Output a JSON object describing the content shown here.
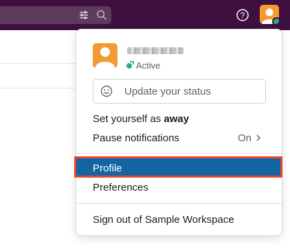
{
  "topbar": {
    "filter_icon": "sliders-icon",
    "search_icon": "search-icon",
    "help_icon": "question-circle-icon",
    "avatar_icon": "user-avatar"
  },
  "menu": {
    "status": "Active",
    "status_placeholder": "Update your status",
    "set_away_prefix": "Set yourself as ",
    "set_away_bold": "away",
    "pause_label": "Pause notifications",
    "pause_value": "On",
    "profile_label": "Profile",
    "preferences_label": "Preferences",
    "signout_label": "Sign out of Sample Workspace"
  },
  "colors": {
    "topbar_bg": "#3f0f3f",
    "avatar_bg": "#f39a34",
    "active_green": "#2bac76",
    "selected_bg": "#1264a3",
    "highlight_border": "#e8442a"
  }
}
